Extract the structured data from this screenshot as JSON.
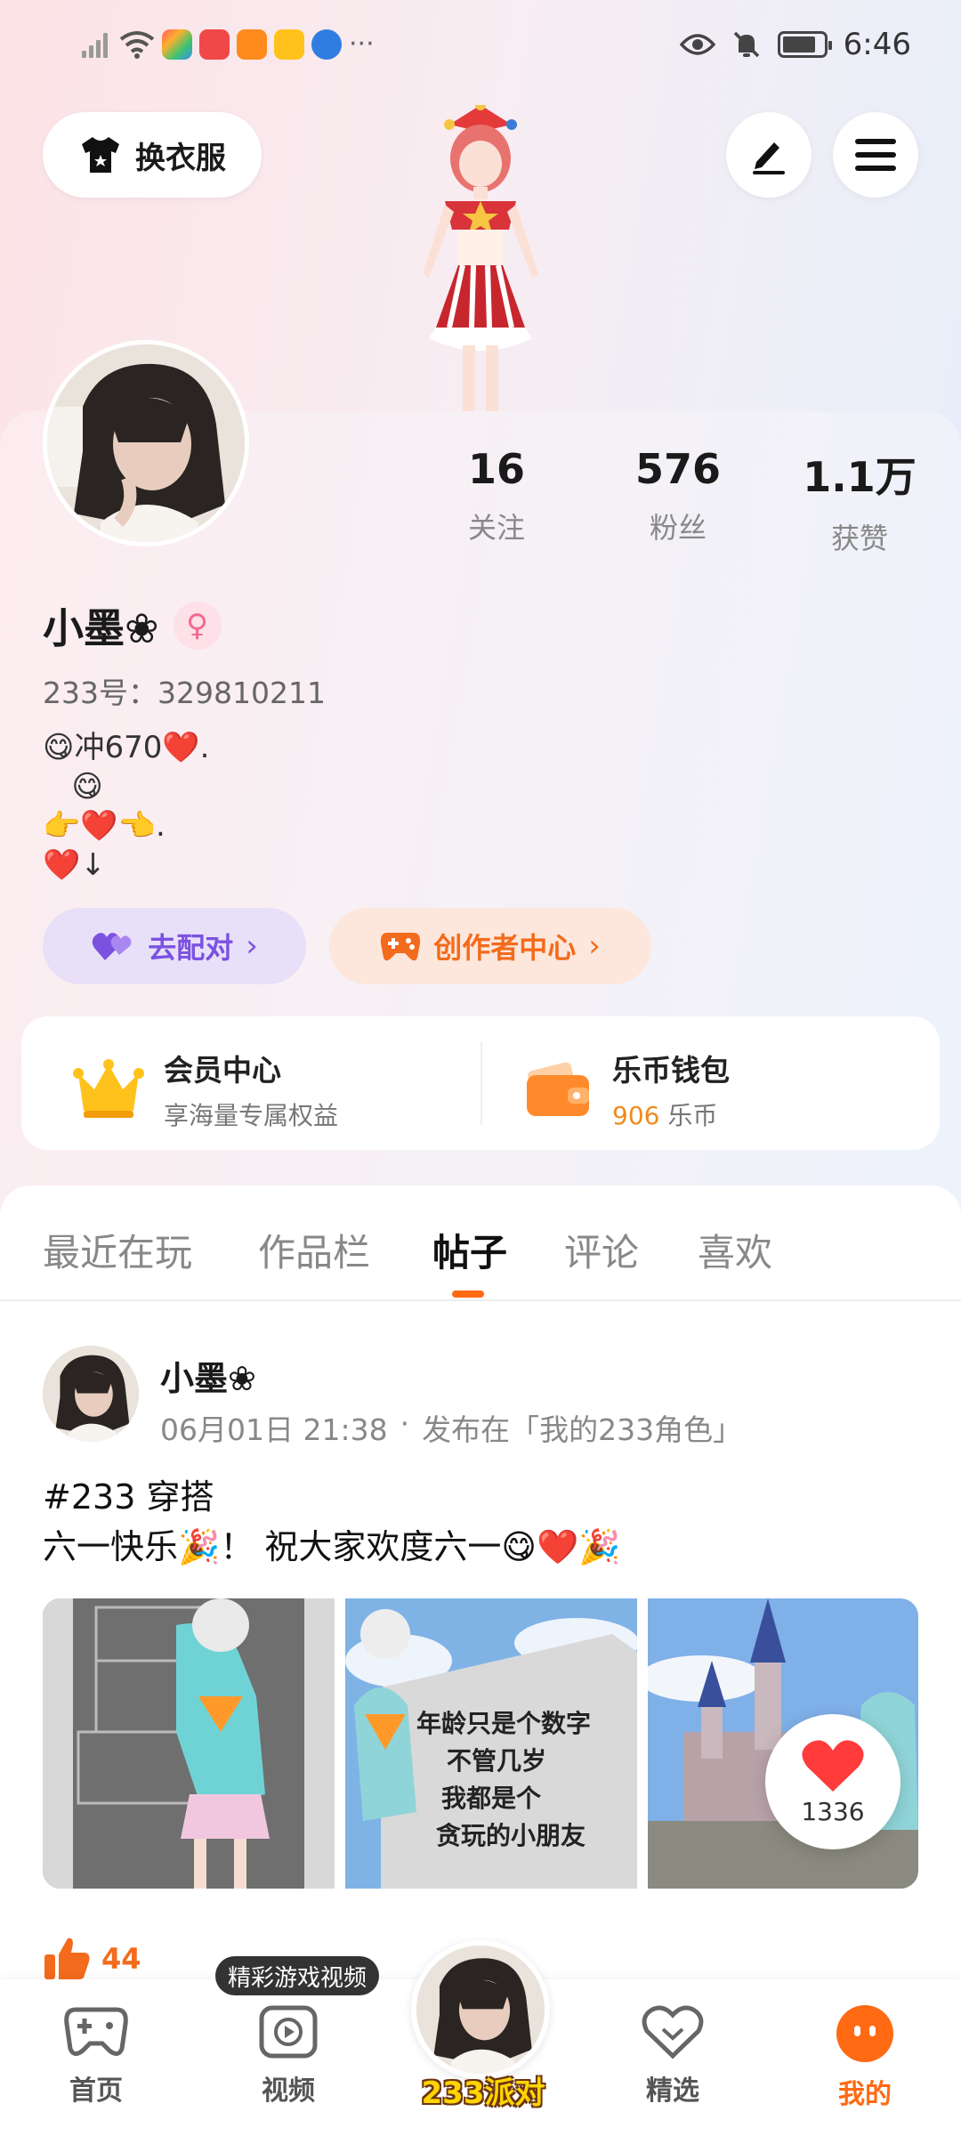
{
  "status_bar": {
    "time": "6:46",
    "more": "···"
  },
  "header": {
    "change_clothes_label": "换衣服"
  },
  "profile": {
    "username": "小墨❀",
    "gender_symbol": "♀",
    "uid": "233号：329810211",
    "bio": "😋冲670❤️.\n   😋\n👉❤️👈.\n❤️↓",
    "stats": [
      {
        "value": "16",
        "label": "关注"
      },
      {
        "value": "576",
        "label": "粉丝"
      },
      {
        "value": "1.1万",
        "label": "获赞"
      }
    ],
    "pair_label": "去配对",
    "creator_label": "创作者中心"
  },
  "vip": {
    "member_title": "会员中心",
    "member_sub": "享海量专属权益",
    "wallet_title": "乐币钱包",
    "wallet_amount": "906",
    "wallet_unit": "乐币"
  },
  "tabs": [
    {
      "label": "最近在玩",
      "active": false
    },
    {
      "label": "作品栏",
      "active": false
    },
    {
      "label": "帖子",
      "active": true
    },
    {
      "label": "评论",
      "active": false
    },
    {
      "label": "喜欢",
      "active": false
    }
  ],
  "post": {
    "author": "小墨❀",
    "date": "06月01日 21:38",
    "dot": "·",
    "published_in": "发布在「我的233角色」",
    "line1": "#233 穿搭",
    "line2": "六一快乐🎉！ 祝大家欢度六一😋❤️🎉",
    "image2_caption": "年龄只是个数字\n不管几岁\n我都是个\n贪玩的小朋友",
    "like_bubble_count": "1336",
    "like_count": "44"
  },
  "bottom_nav": {
    "tooltip": "精彩游戏视频",
    "items": [
      {
        "label": "首页",
        "active": false
      },
      {
        "label": "视频",
        "active": false
      },
      {
        "label": "233派对",
        "active": false
      },
      {
        "label": "精选",
        "active": false
      },
      {
        "label": "我的",
        "active": true
      }
    ]
  },
  "colors": {
    "accent": "#ff6a13",
    "purple": "#7b52e0",
    "coin": "#f08a1f",
    "pink": "#f26a92"
  }
}
